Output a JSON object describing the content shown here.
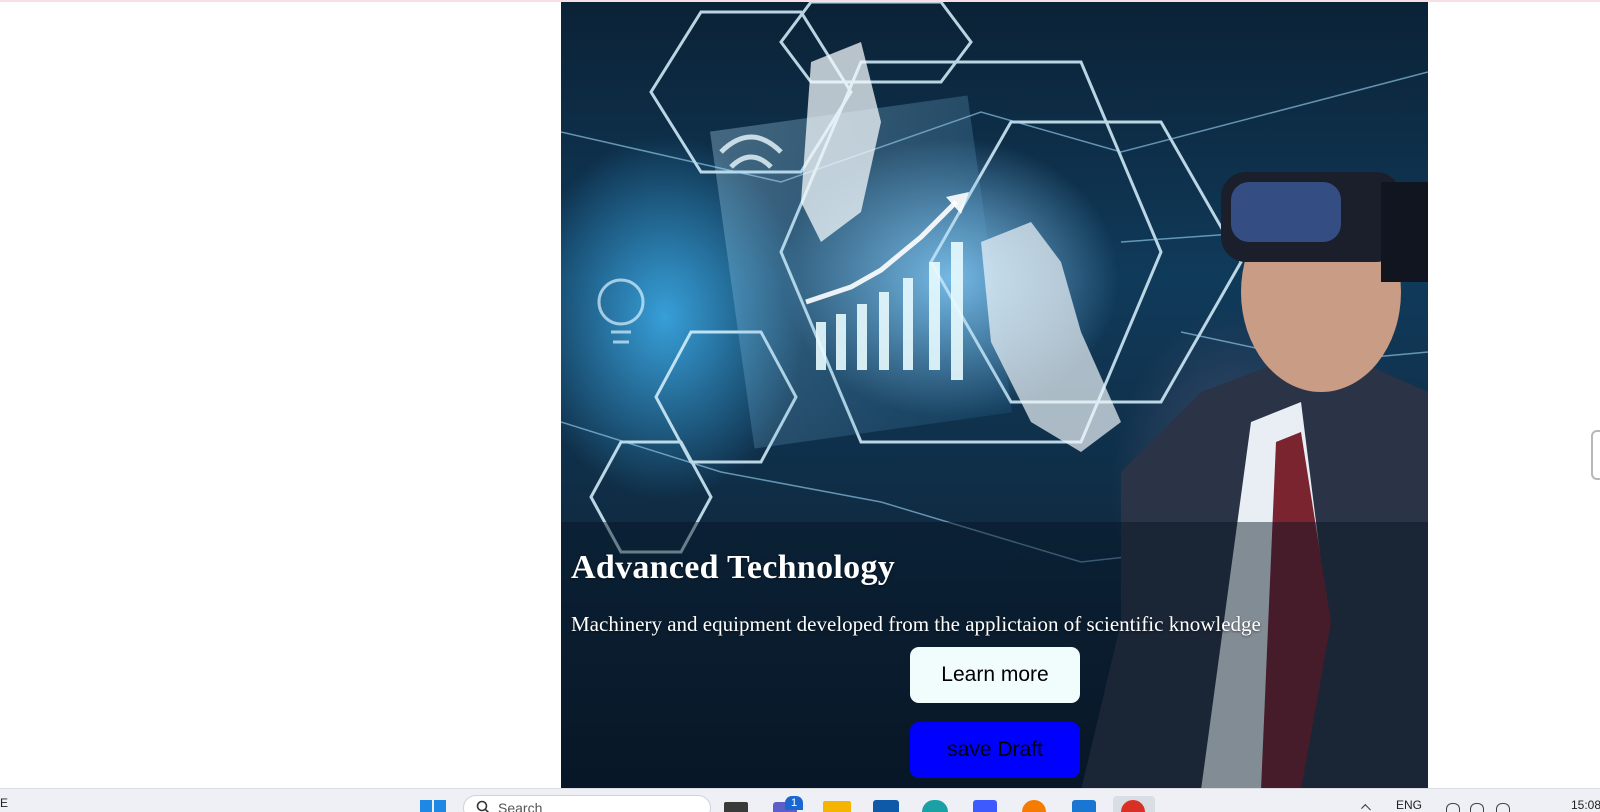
{
  "hero": {
    "title": "Advanced Technology",
    "subtitle": "Machinery and equipment developed from the applictaion of scientific knowledge",
    "learn_more_label": "Learn more",
    "save_draft_label": "save Draft"
  },
  "taskbar": {
    "left_edge_char": "E",
    "search_placeholder": "Search",
    "notification_badge": "1",
    "language": "ENG",
    "clock": "15:08",
    "apps": [
      "task-view-icon",
      "teams-icon",
      "file-explorer-icon",
      "store-icon",
      "edge-icon",
      "vscode-blue-icon",
      "firefox-icon",
      "visual-studio-icon",
      "chrome-icon"
    ]
  },
  "colors": {
    "save_button_bg": "#0000ff",
    "learn_button_bg": "#f1fdfd"
  }
}
